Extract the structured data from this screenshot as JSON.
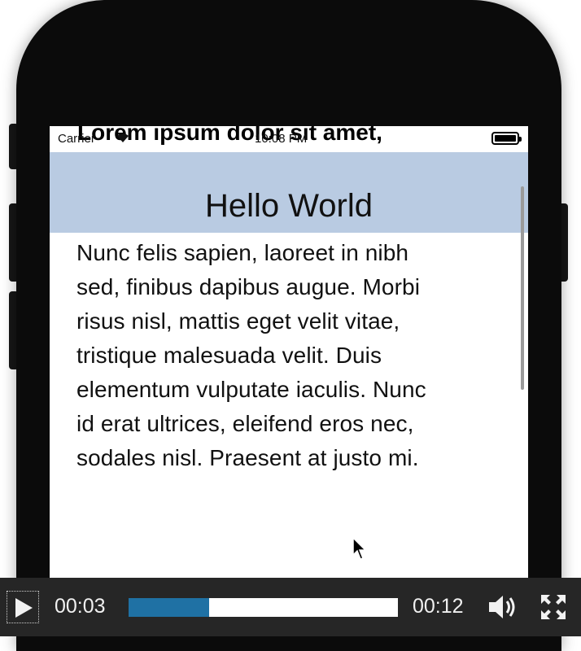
{
  "status_bar": {
    "carrier": "Carrier",
    "time": "10:08 PM"
  },
  "article": {
    "title": "Lorem ipsum dolor sit amet,",
    "lines": [
      "Nunc felis sapien, laoreet in nibh",
      "sed, finibus dapibus augue. Morbi",
      "risus nisl, mattis eget velit vitae,",
      "tristique malesuada velit. Duis",
      "elementum vulputate iaculis. Nunc",
      "id erat ultrices, eleifend eros nec,",
      "sodales nisl. Praesent at justo mi."
    ]
  },
  "navbar": {
    "title": "Hello World",
    "background": "#b9cbe2"
  },
  "video_controls": {
    "current_time": "00:03",
    "total_time": "00:12",
    "progress": 0.3,
    "progress_color": "#1f71a4",
    "play_icon": "play-icon",
    "volume_icon": "speaker-icon",
    "fullscreen_icon": "fullscreen-icon"
  }
}
